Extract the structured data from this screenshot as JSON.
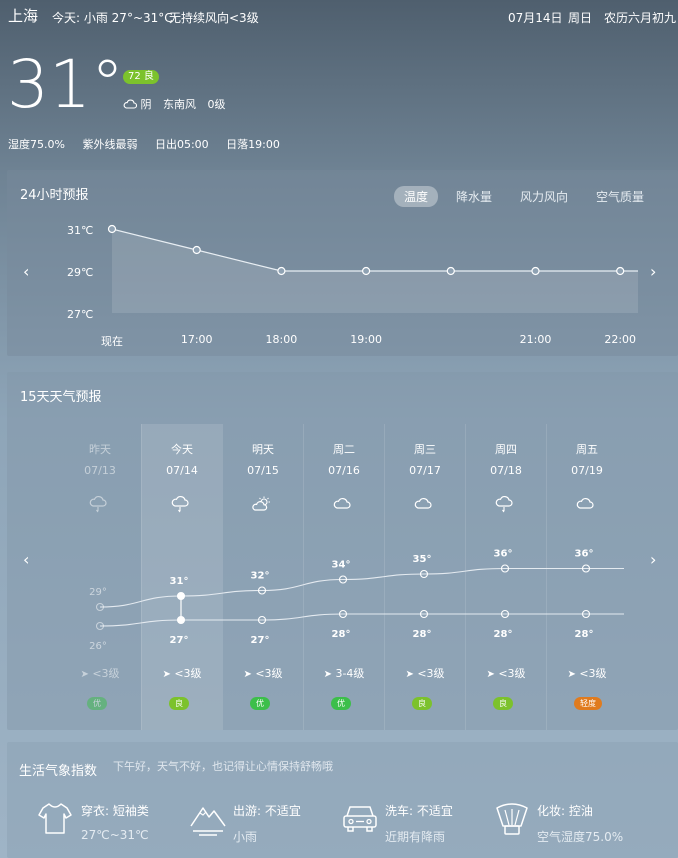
{
  "header": {
    "city": "上海",
    "today_summary": "今天: 小雨 27°~31°C",
    "wind_summary": "无持续风向<3级",
    "date": "07月14日",
    "weekday": "周日",
    "lunar": "农历六月初九"
  },
  "current": {
    "temp": "31°",
    "aqi_badge": "72 良",
    "aqi_color": "#7cc22c",
    "icon": "cloud-icon",
    "condition": "阴",
    "wind_dir": "东南风",
    "wind_level": "0级",
    "humidity": "湿度75.0%",
    "uv": "紫外线最弱",
    "sunrise": "日出05:00",
    "sunset": "日落19:00"
  },
  "hourly": {
    "title": "24小时预报",
    "tabs": [
      "温度",
      "降水量",
      "风力风向",
      "空气质量"
    ],
    "active_tab": 0,
    "chart_data": {
      "type": "area",
      "y_ticks": [
        "31℃",
        "29℃",
        "27℃"
      ],
      "ylim": [
        27,
        31
      ],
      "x": [
        "现在",
        "17:00",
        "18:00",
        "19:00",
        "",
        "21:00",
        "22:00"
      ],
      "values": [
        31,
        30,
        29,
        29,
        29,
        29,
        29
      ]
    }
  },
  "daily": {
    "title": "15天天气预报",
    "chart_data": {
      "type": "line",
      "series": [
        {
          "values": [
            29,
            31,
            32,
            34,
            35,
            36,
            36
          ]
        },
        {
          "values": [
            26,
            27,
            27,
            28,
            28,
            28,
            28
          ]
        }
      ]
    },
    "days": [
      {
        "name": "昨天",
        "date": "07/13",
        "icon": "rain-cloud-icon",
        "high": "29°",
        "low": "26°",
        "wind": "<3级",
        "aq": "优",
        "aq_color": "#3cbf4a"
      },
      {
        "name": "今天",
        "date": "07/14",
        "icon": "rain-cloud-icon",
        "high": "31°",
        "low": "27°",
        "wind": "<3级",
        "aq": "良",
        "aq_color": "#7cc22c"
      },
      {
        "name": "明天",
        "date": "07/15",
        "icon": "sun-cloud-icon",
        "high": "32°",
        "low": "27°",
        "wind": "<3级",
        "aq": "优",
        "aq_color": "#3cbf4a"
      },
      {
        "name": "周二",
        "date": "07/16",
        "icon": "cloud-icon",
        "high": "34°",
        "low": "28°",
        "wind": "3-4级",
        "aq": "优",
        "aq_color": "#3cbf4a"
      },
      {
        "name": "周三",
        "date": "07/17",
        "icon": "cloud-icon",
        "high": "35°",
        "low": "28°",
        "wind": "<3级",
        "aq": "良",
        "aq_color": "#7cc22c"
      },
      {
        "name": "周四",
        "date": "07/18",
        "icon": "rain-cloud-icon",
        "high": "36°",
        "low": "28°",
        "wind": "<3级",
        "aq": "良",
        "aq_color": "#7cc22c"
      },
      {
        "name": "周五",
        "date": "07/19",
        "icon": "cloud-icon",
        "high": "36°",
        "low": "28°",
        "wind": "<3级",
        "aq": "轻度",
        "aq_color": "#e07b1e"
      }
    ]
  },
  "life": {
    "title": "生活气象指数",
    "subtitle": "下午好，天气不好，也记得让心情保持舒畅哦",
    "items": [
      {
        "icon": "tshirt-icon",
        "label": "穿衣: 短袖类",
        "sub": "27℃~31℃"
      },
      {
        "icon": "mountain-icon",
        "label": "出游: 不适宜",
        "sub": "小雨"
      },
      {
        "icon": "car-icon",
        "label": "洗车: 不适宜",
        "sub": "近期有降雨"
      },
      {
        "icon": "cosmetic-icon",
        "label": "化妆: 控油",
        "sub": "空气湿度75.0%"
      }
    ]
  }
}
